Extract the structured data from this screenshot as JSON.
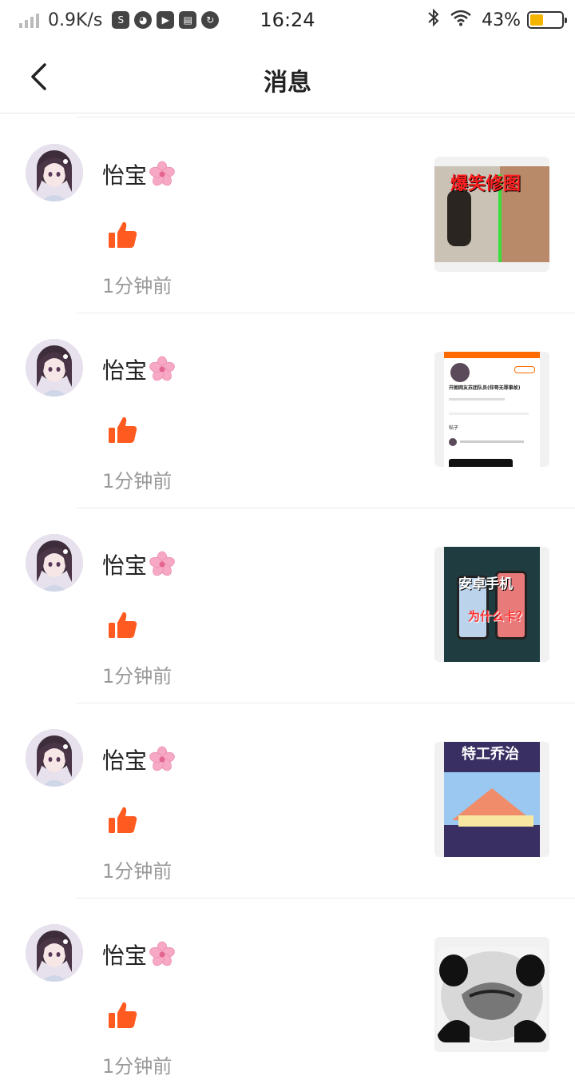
{
  "status_bar": {
    "net_speed": "0.9K/s",
    "time": "16:24",
    "battery": "43%",
    "battery_level": 0.43,
    "icons": [
      "signal-icon",
      "sync-icon",
      "cat-icon",
      "play-icon",
      "card-icon",
      "refresh-icon",
      "bluetooth-icon",
      "wifi-icon",
      "battery-icon"
    ]
  },
  "nav": {
    "title": "消息",
    "back_icon": "chevron-left-icon"
  },
  "colors": {
    "like": "#ff5a1f",
    "time": "#999999",
    "divider": "#ececec",
    "battery": "#f4b400"
  },
  "messages": [
    {
      "user": "怡宝",
      "time": "1分钟前",
      "action_icon": "thumbs-up-icon",
      "thumb_text": "爆笑修图",
      "thumb_text2": ""
    },
    {
      "user": "怡宝",
      "time": "1分钟前",
      "action_icon": "thumbs-up-icon",
      "thumb_text": "开朗网友苏团队员(仰哥无罪事故)",
      "thumb_text2": "帖子"
    },
    {
      "user": "怡宝",
      "time": "1分钟前",
      "action_icon": "thumbs-up-icon",
      "thumb_text": "安卓手机",
      "thumb_text2": "为什么卡？"
    },
    {
      "user": "怡宝",
      "time": "1分钟前",
      "action_icon": "thumbs-up-icon",
      "thumb_text": "特工乔治",
      "thumb_text2": ""
    },
    {
      "user": "怡宝",
      "time": "1分钟前",
      "action_icon": "thumbs-up-icon",
      "thumb_text": "",
      "thumb_text2": ""
    }
  ]
}
